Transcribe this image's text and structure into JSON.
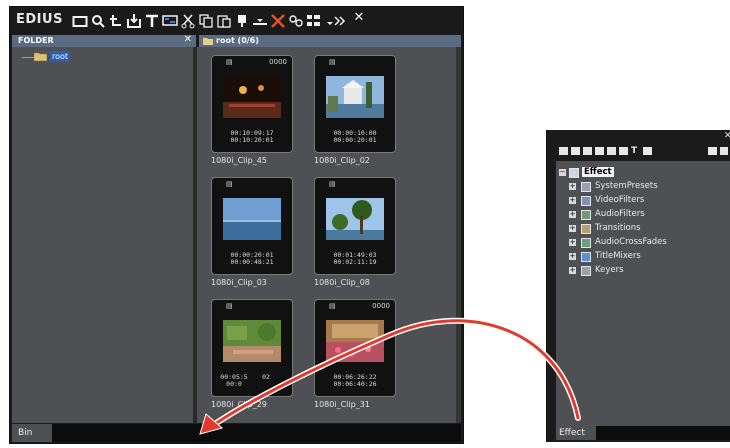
{
  "bin_window": {
    "brand": "EDIUS",
    "toolbar_icons": [
      "new-folder-icon",
      "search-icon",
      "parent-folder-icon",
      "import-icon",
      "title-icon",
      "sequence-icon",
      "cut-icon",
      "copy-icon",
      "paste-icon",
      "add-to-timeline-icon",
      "replace-icon",
      "delete-icon",
      "properties-icon",
      "view-mode-icon",
      "dropdown-icon",
      "more-icon"
    ],
    "folder_pane": {
      "header": "FOLDER",
      "root_label": "root"
    },
    "clip_pane": {
      "header": "root (0/6)"
    },
    "clips": [
      {
        "name": "1080i_Clip_45",
        "code": "0000",
        "tc_in": "00:10:09:17",
        "tc_out": "00:10:20:01",
        "thumb": "restaurant"
      },
      {
        "name": "1080i_Clip_02",
        "code": "",
        "tc_in": "00:00:10:00",
        "tc_out": "00:00:20:01",
        "thumb": "gazebo"
      },
      {
        "name": "1080i_Clip_03",
        "code": "",
        "tc_in": "00:00:20:01",
        "tc_out": "00:00:48:21",
        "thumb": "sea"
      },
      {
        "name": "1080i_Clip_08",
        "code": "",
        "tc_in": "00:01:49:03",
        "tc_out": "00:02:11:19",
        "thumb": "trees"
      },
      {
        "name": "1080i_Clip_29",
        "code": "",
        "tc_in": "00:05:5",
        "tc_out": "00:0",
        "tc_in_tail": "02",
        "thumb": "garden"
      },
      {
        "name": "1080i_Clip_31",
        "code": "0000",
        "tc_in": "00:06:26:22",
        "tc_out": "00:06:40:26",
        "thumb": "flowers"
      }
    ],
    "tab_label": "Bin"
  },
  "effect_window": {
    "root_label": "Effect",
    "items": [
      "SystemPresets",
      "VideoFilters",
      "AudioFilters",
      "Transitions",
      "AudioCrossFades",
      "TitleMixers",
      "Keyers"
    ],
    "tab_label": "Effect"
  },
  "colors": {
    "panel_header": "#5a6b82",
    "pane_bg": "#4f5053",
    "arrow": "#e03a2f",
    "selection": "#2a5fb0"
  }
}
